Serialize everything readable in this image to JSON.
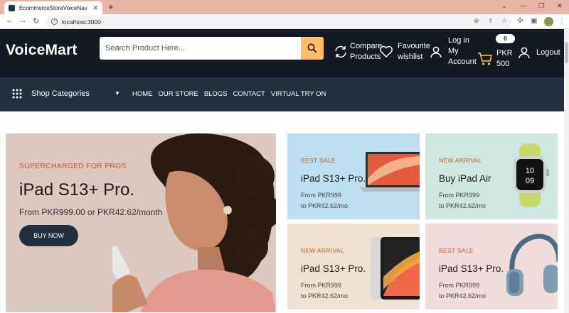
{
  "browser": {
    "tab_title": "EcommerceStoreVoiceNav",
    "url": "localhost:3000"
  },
  "header": {
    "logo": "VoiceMart",
    "search_placeholder": "Search Product Here...",
    "compare": [
      "Compare",
      "Products"
    ],
    "favourite": [
      "Favourite",
      "wishlist"
    ],
    "login": [
      "Log in",
      "My",
      "Account"
    ],
    "cart_count": "0",
    "cart_currency": "PKR",
    "cart_total": "500",
    "logout": "Logout"
  },
  "nav": {
    "categories_label": "Shop Categories",
    "menu": [
      "HOME",
      "OUR STORE",
      "BLOGS",
      "CONTACT",
      "VIRTUAL TRY ON"
    ]
  },
  "hero": {
    "eyebrow": "SUPERCHARGED FOR PROS",
    "title": "iPad S13+ Pro.",
    "price": "From PKR999.00 or PKR42.62/month",
    "button": "BUY NOW"
  },
  "cards": [
    {
      "tag": "BEST SALE",
      "title": "iPad S13+ Pro.",
      "line1": "From PKR999",
      "line2": "to PKR42.62/mo",
      "bg": "#bfdff0",
      "image": "laptop"
    },
    {
      "tag": "NEW ARRIVAL",
      "title": "Buy iPad Air",
      "line1": "From PKR999",
      "line2": "to PKR42.62/mo",
      "bg": "#cfe6e1",
      "image": "smartwatch"
    },
    {
      "tag": "NEW ARRIVAL",
      "title": "iPad S13+ Pro.",
      "line1": "From PKR999",
      "line2": "to PKR42.62/mo",
      "bg": "#efe2d2",
      "image": "tablet"
    },
    {
      "tag": "BEST SALE",
      "title": "iPad S13+ Pro.",
      "line1": "From PKR999",
      "line2": "to PKR42.62/mo",
      "bg": "#f1dcdc",
      "image": "headphones"
    }
  ],
  "colors": {
    "header_bg": "#131921",
    "nav_bg": "#232f3e",
    "accent": "#febd69",
    "tag": "#bd5e2d"
  }
}
